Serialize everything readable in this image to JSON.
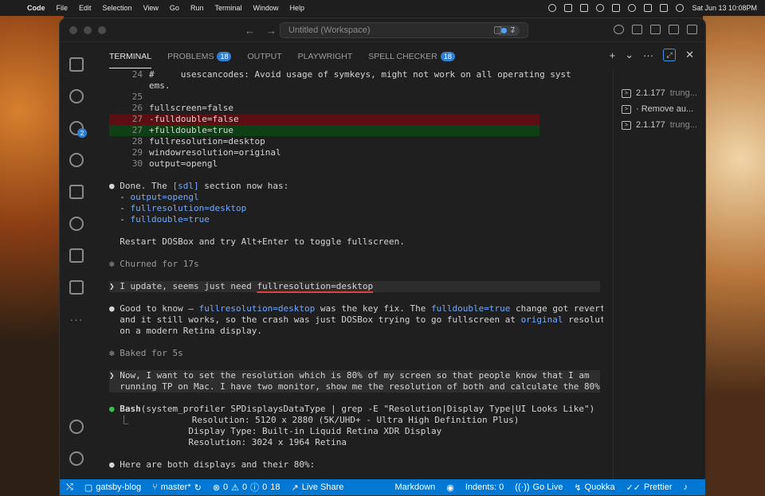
{
  "menubar": {
    "app_name": "Code",
    "items": [
      "File",
      "Edit",
      "Selection",
      "View",
      "Go",
      "Run",
      "Terminal",
      "Window",
      "Help"
    ],
    "clock": "Sat Jun 13  10:08PM"
  },
  "titlebar": {
    "search_text": "Untitled (Workspace)",
    "counter": "7"
  },
  "activity": {
    "scm_badge": "2"
  },
  "panel": {
    "tabs": [
      {
        "label": "TERMINAL",
        "badge": ""
      },
      {
        "label": "PROBLEMS",
        "badge": "18"
      },
      {
        "label": "OUTPUT",
        "badge": ""
      },
      {
        "label": "PLAYWRIGHT",
        "badge": ""
      },
      {
        "label": "SPELL CHECKER",
        "badge": "18"
      }
    ]
  },
  "terminal": {
    "lines": {
      "l24_num": "24",
      "l24a": "#     usescancodes: Avoid usage of symkeys, might not work on all operating syst",
      "l24b": "ems.",
      "l25_num": "25",
      "l26_num": "26",
      "l26": "fullscreen=false",
      "l27d_num": "27",
      "l27d": "-fulldouble=false",
      "l27a_num": "27",
      "l27a": "+fulldouble=true",
      "l28_num": "28",
      "l28": "fullresolution=desktop",
      "l29_num": "29",
      "l29": "windowresolution=original",
      "l30_num": "30",
      "l30": "output=opengl",
      "done_a": "● Done. The ",
      "done_b": "[sdl]",
      "done_c": " section now has:",
      "b1_dash": "  - ",
      "b1": "output=opengl",
      "b2": "fullresolution=desktop",
      "b3": "fulldouble=true",
      "restart": "  Restart DOSBox and try Alt+Enter to toggle fullscreen.",
      "churned": "✻ Churned for 17s",
      "prompt1_a": "❯ I update, seems just need ",
      "prompt1_b": "fullresolution=desktop",
      "good_a": "● Good to know — ",
      "good_b": "fullresolution=desktop",
      "good_c": " was the key fix. The ",
      "good_d": "fulldouble=true",
      "good_e": " change got reverted",
      "good2_a": "  and it still works, so the crash was just DOSBox trying to go fullscreen at ",
      "good2_b": "original",
      "good2_c": " resolution",
      "good3": "  on a modern Retina display.",
      "baked": "✻ Baked for 5s",
      "prompt2_a": "❯ Now, I want to set the resolution which is 80% of my screen so that people know that I am",
      "prompt2_b": "  running TP on Mac. I have two monitor, show me the resolution of both and calculate the 80%",
      "bash_dot": "● ",
      "bash_name": "Bash",
      "bash_cmd": "(system_profiler SPDisplaysDataType | grep -E \"Resolution|Display Type|UI Looks Like\")",
      "out1": "  ⎿            Resolution: 5120 x 2880 (5K/UHD+ - Ultra High Definition Plus)",
      "out2": "               Display Type: Built-in Liquid Retina XDR Display",
      "out3": "               Resolution: 3024 x 1964 Retina",
      "here": "● Here are both displays and their 80%:"
    }
  },
  "term_list": {
    "items": [
      {
        "title": "2.1.177",
        "sub": "trung..."
      },
      {
        "title": "· Remove au...",
        "sub": ""
      },
      {
        "title": "2.1.177",
        "sub": "trung..."
      }
    ]
  },
  "statusbar": {
    "folder": "gatsby-blog",
    "branch": "master*",
    "errors": "0",
    "warnings": "0",
    "info": "0",
    "ports": "18",
    "live_share": "Live Share",
    "language": "Markdown",
    "indents": "Indents: 0",
    "go_live": "Go Live",
    "quokka": "Quokka",
    "prettier": "Prettier"
  }
}
